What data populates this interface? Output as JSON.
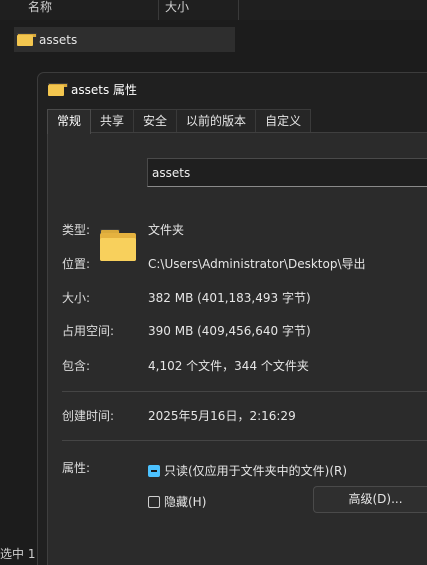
{
  "explorer": {
    "columns": {
      "name": "名称",
      "size": "大小"
    },
    "item": {
      "name": "assets",
      "icon": "folder-icon"
    },
    "status": "选中 1"
  },
  "dialog": {
    "title": "assets 属性",
    "tabs": [
      {
        "label": "常规",
        "active": true
      },
      {
        "label": "共享",
        "active": false
      },
      {
        "label": "安全",
        "active": false
      },
      {
        "label": "以前的版本",
        "active": false
      },
      {
        "label": "自定义",
        "active": false
      }
    ],
    "general": {
      "name_value": "assets",
      "type_label": "类型:",
      "type_value": "文件夹",
      "location_label": "位置:",
      "location_value": "C:\\Users\\Administrator\\Desktop\\导出",
      "size_label": "大小:",
      "size_value": "382 MB (401,183,493 字节)",
      "disk_label": "占用空间:",
      "disk_value": "390 MB (409,456,640 字节)",
      "contains_label": "包含:",
      "contains_value": "4,102 个文件，344 个文件夹",
      "created_label": "创建时间:",
      "created_value": "2025年5月16日，2:16:29",
      "attributes_label": "属性:",
      "readonly_label": "只读(仅应用于文件夹中的文件)(R)",
      "readonly_state": "indeterminate",
      "hidden_label": "隐藏(H)",
      "hidden_state": "unchecked",
      "advanced_button": "高级(D)..."
    }
  },
  "colors": {
    "accent": "#4cc2ff",
    "folder": "#f3c64f",
    "background": "#1c1c1c",
    "dialog": "#202020",
    "panel": "#2b2b2b"
  }
}
